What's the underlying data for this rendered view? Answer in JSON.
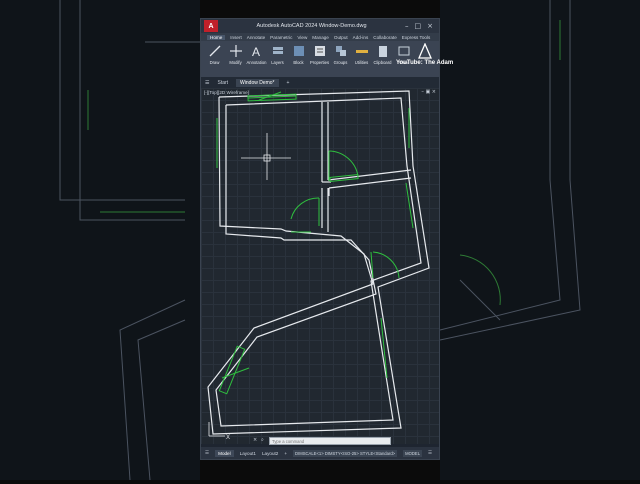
{
  "app": {
    "logo": "A",
    "title": "Autodesk AutoCAD 2024   Window-Demo.dwg"
  },
  "menu_tabs": [
    "Home",
    "Insert",
    "Annotate",
    "Parametric",
    "View",
    "Manage",
    "Output",
    "Add-ins",
    "Collaborate",
    "Express Tools"
  ],
  "ribbon_buttons": [
    "Draw",
    "Modify",
    "Annotation",
    "Layers",
    "Block",
    "Properties",
    "Groups",
    "Utilities",
    "Clipboard",
    "View"
  ],
  "file_tabs": [
    "Start",
    "Window Demo*"
  ],
  "viewport_label": "[-][Top][2D Wireframe]",
  "overlay_text": "YouTube: The Adam",
  "command_placeholder": "Type a command",
  "status_tabs": [
    "Model",
    "Layout1",
    "Layout2"
  ],
  "status_info": "DIMSCALE<1> DIMSTY<ISO-25> STYLE<Standard>",
  "status_model": "MODEL",
  "colors": {
    "wall": "#e6e9ed",
    "window": "#2fbf3f",
    "accent": "#c0202a"
  }
}
